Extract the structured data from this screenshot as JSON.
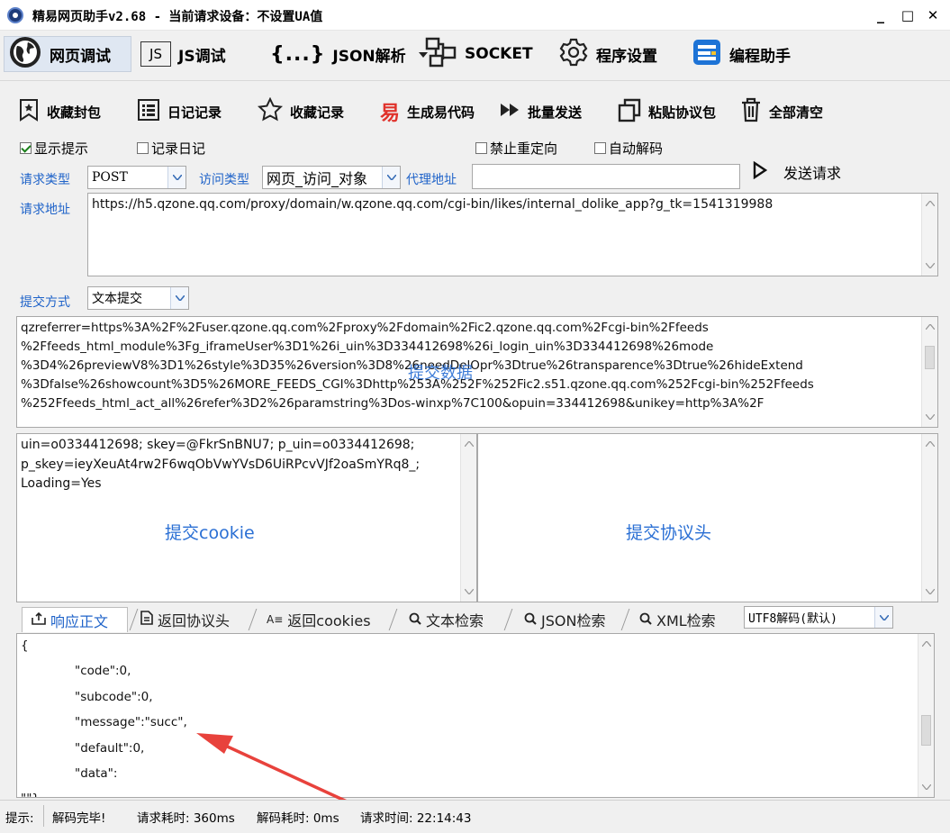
{
  "window": {
    "title": "精易网页助手v2.68    -    当前请求设备：不设置UA值",
    "minimize": "_",
    "maximize": "□",
    "close": "✕"
  },
  "main_toolbar": [
    {
      "label": "网页调试",
      "icon": "globe-icon",
      "active": true
    },
    {
      "label": "JS调试",
      "icon": "js-icon"
    },
    {
      "label": "JSON解析",
      "icon": "braces-icon",
      "dropdown": true
    },
    {
      "label": "SOCKET",
      "icon": "network-icon"
    },
    {
      "label": "程序设置",
      "icon": "gear-icon"
    },
    {
      "label": "编程助手",
      "icon": "code-assistant-icon"
    }
  ],
  "json_icon_text": "{...}",
  "js_icon_text": "JS",
  "sub_toolbar": [
    {
      "label": "收藏封包",
      "icon": "bookmark-icon"
    },
    {
      "label": "日记记录",
      "icon": "list-icon"
    },
    {
      "label": "收藏记录",
      "icon": "star-icon"
    },
    {
      "label": "生成易代码",
      "icon": "yi-icon",
      "icon_text": "易"
    },
    {
      "label": "批量发送",
      "icon": "fast-forward-icon"
    },
    {
      "label": "粘贴协议包",
      "icon": "paste-icon"
    },
    {
      "label": "全部清空",
      "icon": "trash-icon"
    }
  ],
  "options": {
    "show_tips": {
      "label": "显示提示",
      "checked": true
    },
    "log_diary": {
      "label": "记录日记",
      "checked": false
    },
    "no_redirect": {
      "label": "禁止重定向",
      "checked": false
    },
    "auto_decode": {
      "label": "自动解码",
      "checked": false
    }
  },
  "request": {
    "type_label": "请求类型",
    "type_value": "POST",
    "access_label": "访问类型",
    "access_value": "网页_访问_对象",
    "proxy_label": "代理地址",
    "proxy_value": "",
    "send_label": "发送请求",
    "url_label": "请求地址",
    "url_value": "https://h5.qzone.qq.com/proxy/domain/w.qzone.qq.com/cgi-bin/likes/internal_dolike_app?g_tk=1541319988",
    "submit_mode_label": "提交方式",
    "submit_mode_value": "文本提交"
  },
  "post_data": {
    "lines": [
      "qzreferrer=https%3A%2F%2Fuser.qzone.qq.com%2Fproxy%2Fdomain%2Fic2.qzone.qq.com%2Fcgi-bin%2Ffeeds",
      "%2Ffeeds_html_module%3Fg_iframeUser%3D1%26i_uin%3D334412698%26i_login_uin%3D334412698%26mode",
      "%3D4%26previewV8%3D1%26style%3D35%26version%3D8%26needDelOpr%3Dtrue%26transparence%3Dtrue%26hideExtend",
      "%3Dfalse%26showcount%3D5%26MORE_FEEDS_CGI%3Dhttp%253A%252F%252Fic2.s51.qzone.qq.com%252Fcgi-bin%252Ffeeds",
      "%252Ffeeds_html_act_all%26refer%3D2%26paramstring%3Dos-winxp%7C100&opuin=334412698&unikey=http%3A%2F"
    ],
    "hint": "提交数据"
  },
  "cookie": {
    "lines": [
      "uin=o0334412698; skey=@FkrSnBNU7; p_uin=o0334412698;",
      "p_skey=ieyXeuAt4rw2F6wqObVwYVsD6UiRPcvVJf2oaSmYRq8_;",
      "Loading=Yes"
    ],
    "hint": "提交cookie"
  },
  "headers": {
    "hint": "提交协议头"
  },
  "response_tabs": [
    {
      "label": "响应正文",
      "icon": "response-icon",
      "active": true
    },
    {
      "label": "返回协议头",
      "icon": "document-icon"
    },
    {
      "label": "返回cookies",
      "icon": "cookie-text-icon",
      "icon_text": "A≡"
    },
    {
      "label": "文本检索",
      "icon": "search-icon"
    },
    {
      "label": "JSON检索",
      "icon": "search-icon"
    },
    {
      "label": "XML检索",
      "icon": "search-icon"
    }
  ],
  "decode": {
    "value": "UTF8解码(默认)"
  },
  "response_body": {
    "lines": [
      "{",
      "\"code\":0,",
      "\"subcode\":0,",
      "\"message\":\"succ\",",
      "\"default\":0,",
      "\"data\":",
      "\"\"}"
    ]
  },
  "annotation": {
    "color": "#e8423c"
  },
  "status_bar": {
    "tip_label": "提示:",
    "decode_done": "解码完毕!",
    "request_time": "请求耗时: 360ms",
    "decode_time": "解码耗时: 0ms",
    "request_at": "请求时间: 22:14:43"
  }
}
